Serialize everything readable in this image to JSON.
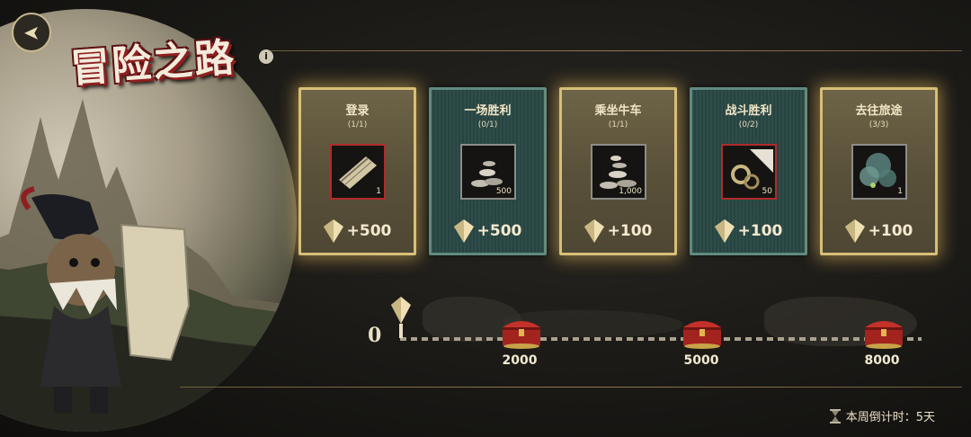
{
  "header": {
    "title": "冒险之路",
    "info_symbol": "i",
    "back_symbol": "➤"
  },
  "tasks": [
    {
      "name": "登录",
      "progress": "(1/1)",
      "qty": "1",
      "reward": "+500",
      "style": "gold",
      "thumb": "scroll-icon"
    },
    {
      "name": "一场胜利",
      "progress": "(0/1)",
      "qty": "500",
      "reward": "+500",
      "style": "teal",
      "thumb": "coins-icon"
    },
    {
      "name": "乘坐牛车",
      "progress": "(1/1)",
      "qty": "1,000",
      "reward": "+100",
      "style": "gold",
      "thumb": "coins-icon"
    },
    {
      "name": "战斗胜利",
      "progress": "(0/2)",
      "qty": "50",
      "reward": "+100",
      "style": "teal",
      "thumb": "rings-icon"
    },
    {
      "name": "去往旅途",
      "progress": "(3/3)",
      "qty": "1",
      "reward": "+100",
      "style": "gold",
      "thumb": "smoke-icon"
    }
  ],
  "progress": {
    "current": "0",
    "milestones": [
      "2000",
      "5000",
      "8000"
    ]
  },
  "countdown": {
    "label": "本周倒计时：5天"
  },
  "colors": {
    "accent_gold": "#d7bf78",
    "teal_card": "#2e4d4a",
    "title_red": "#8e1f1f"
  }
}
